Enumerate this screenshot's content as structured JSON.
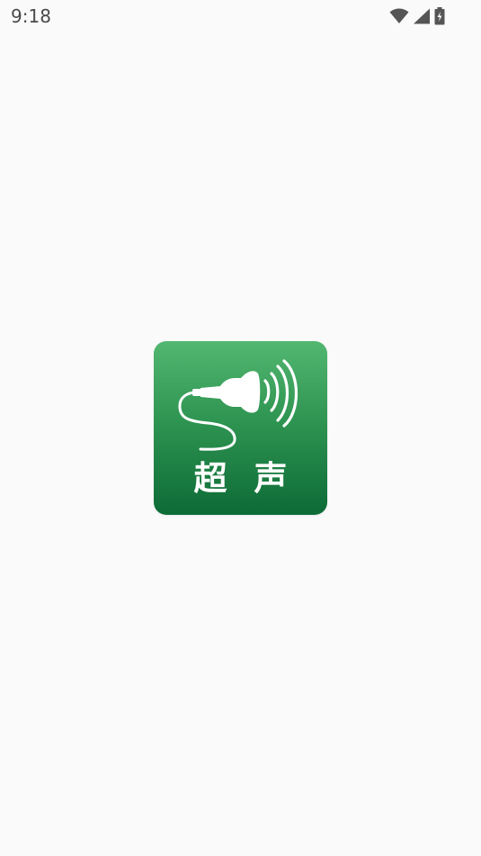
{
  "status_bar": {
    "time": "9:18",
    "icons": [
      "wifi-icon",
      "cellular-signal-icon",
      "battery-charging-icon"
    ]
  },
  "splash": {
    "logo": {
      "label_chars": [
        "超",
        "声"
      ],
      "gradient_top": "#52b770",
      "gradient_bottom": "#0d6b36",
      "icon": "ultrasound-probe-icon"
    }
  },
  "colors": {
    "background": "#fafafa",
    "status_text": "#4a4a4a"
  }
}
